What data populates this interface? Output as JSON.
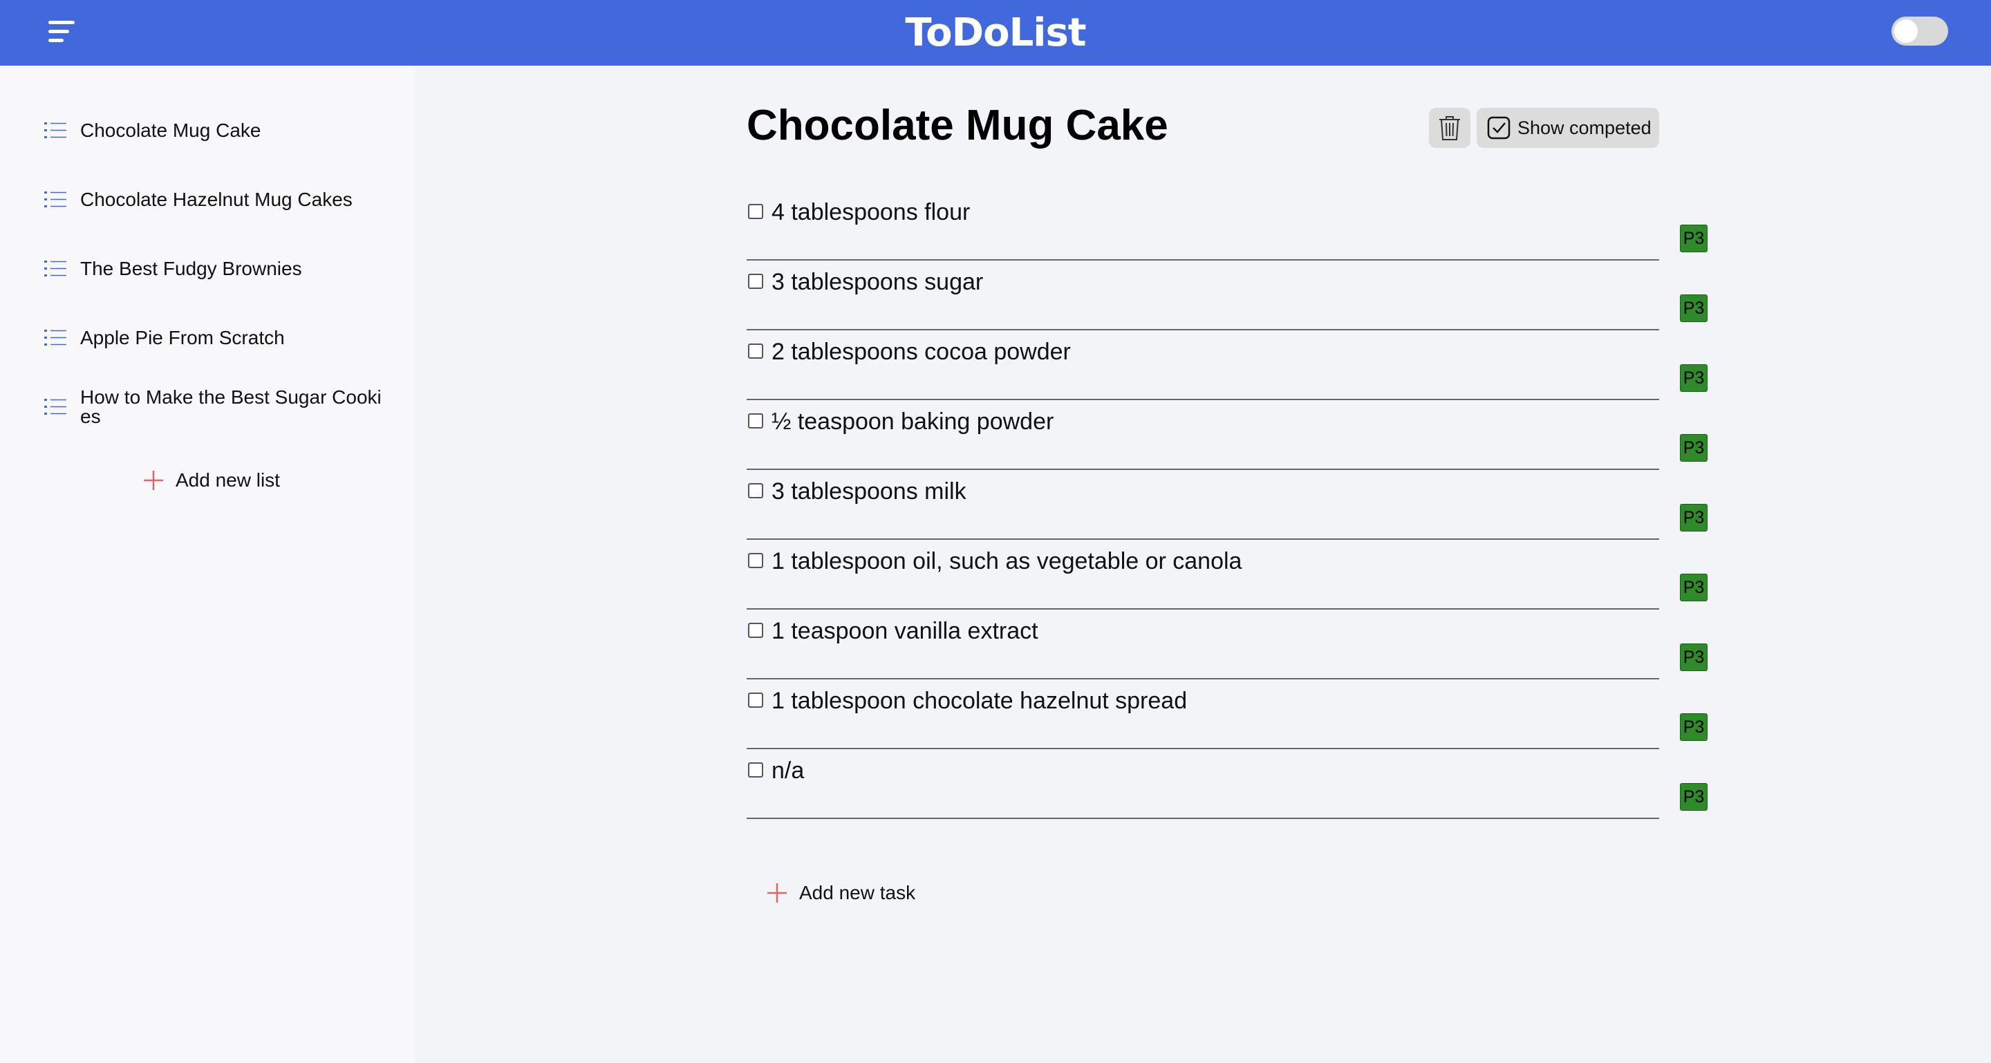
{
  "header": {
    "title": "ToDoList",
    "menu_icon": "hamburger-menu-icon",
    "theme_toggle": "off"
  },
  "sidebar": {
    "items": [
      {
        "label": "Chocolate Mug Cake",
        "icon": "list-icon"
      },
      {
        "label": "Chocolate Hazelnut Mug Cakes",
        "icon": "list-icon"
      },
      {
        "label": "The Best Fudgy Brownies",
        "icon": "list-icon"
      },
      {
        "label": "Apple Pie From Scratch",
        "icon": "list-icon"
      },
      {
        "label": "How to Make the Best Sugar Cookies",
        "icon": "list-icon"
      }
    ],
    "add_list_label": "Add new list"
  },
  "main": {
    "title": "Chocolate Mug Cake",
    "show_completed_label": "Show competed",
    "add_task_label": "Add new task",
    "tasks": [
      {
        "text": "4 tablespoons flour",
        "priority": "P3",
        "done": false
      },
      {
        "text": "3 tablespoons sugar",
        "priority": "P3",
        "done": false
      },
      {
        "text": "2 tablespoons cocoa powder",
        "priority": "P3",
        "done": false
      },
      {
        "text": "½ teaspoon baking powder",
        "priority": "P3",
        "done": false
      },
      {
        "text": "3 tablespoons milk",
        "priority": "P3",
        "done": false
      },
      {
        "text": "1 tablespoon oil, such as vegetable or canola",
        "priority": "P3",
        "done": false
      },
      {
        "text": "1 teaspoon vanilla extract",
        "priority": "P3",
        "done": false
      },
      {
        "text": "1 tablespoon chocolate hazelnut spread",
        "priority": "P3",
        "done": false
      },
      {
        "text": "n/a",
        "priority": "P3",
        "done": false
      }
    ]
  },
  "colors": {
    "header_bg": "#4169db",
    "priority_badge": "#2f8a2a",
    "add_plus": "#e06666",
    "list_icon": "#4169db"
  }
}
